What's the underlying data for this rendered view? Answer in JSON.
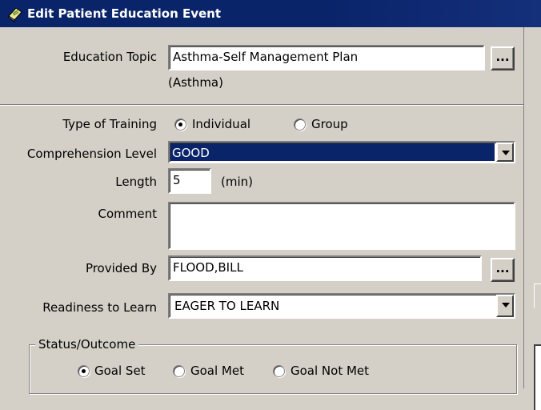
{
  "window": {
    "title": "Edit Patient Education Event"
  },
  "education_topic": {
    "label": "Education Topic",
    "value": "Asthma-Self Management Plan",
    "category": "(Asthma)",
    "browse_label": "..."
  },
  "type_of_training": {
    "label": "Type of Training",
    "options": [
      "Individual",
      "Group"
    ],
    "selected": "Individual"
  },
  "comprehension_level": {
    "label": "Comprehension Level",
    "value": "GOOD"
  },
  "length": {
    "label": "Length",
    "value": "5",
    "unit": "(min)"
  },
  "comment": {
    "label": "Comment",
    "value": ""
  },
  "provided_by": {
    "label": "Provided By",
    "value": "FLOOD,BILL",
    "browse_label": "..."
  },
  "readiness": {
    "label": "Readiness to Learn",
    "value": "EAGER TO LEARN"
  },
  "status_outcome": {
    "title": "Status/Outcome",
    "options": [
      "Goal Set",
      "Goal Met",
      "Goal Not Met"
    ],
    "selected": "Goal Set"
  },
  "colors": {
    "title_bar": "#0a246a",
    "selection": "#0a246a",
    "face": "#d4d0c8"
  }
}
